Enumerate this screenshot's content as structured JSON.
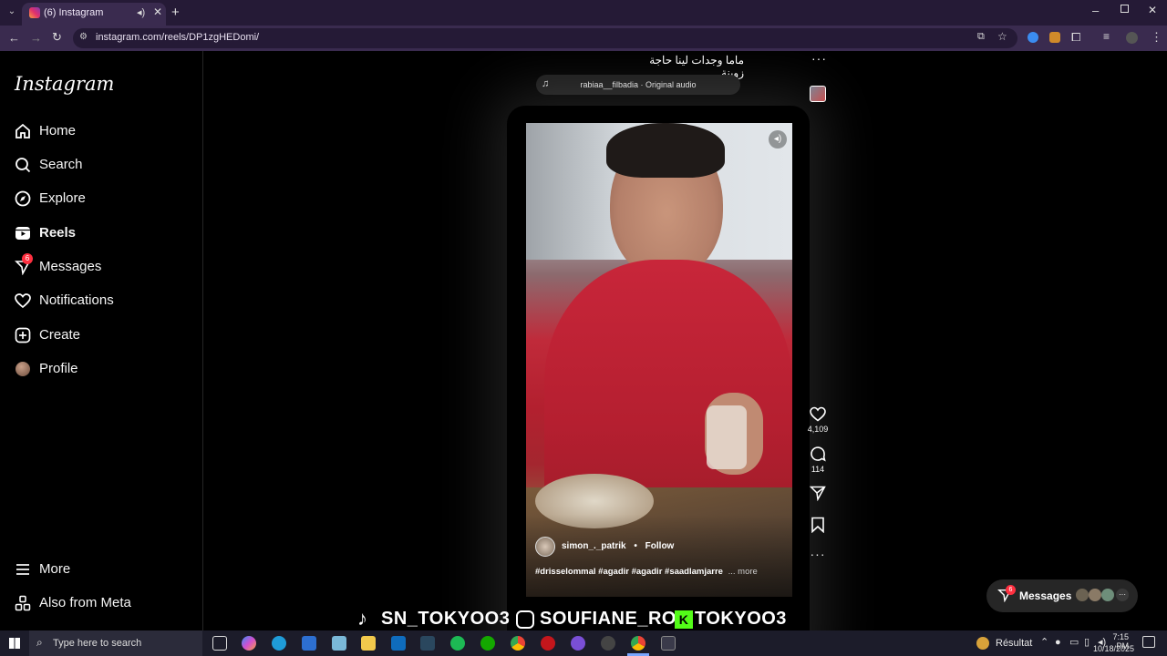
{
  "browser": {
    "tab_title": "(6) Instagram",
    "url": "instagram.com/reels/DP1zgHEDomi/"
  },
  "sidebar": {
    "logo": "Instagram",
    "items": [
      {
        "label": "Home",
        "icon": "home-icon"
      },
      {
        "label": "Search",
        "icon": "search-icon"
      },
      {
        "label": "Explore",
        "icon": "compass-icon"
      },
      {
        "label": "Reels",
        "icon": "reels-icon"
      },
      {
        "label": "Messages",
        "icon": "messenger-icon",
        "badge": "6"
      },
      {
        "label": "Notifications",
        "icon": "heart-icon"
      },
      {
        "label": "Create",
        "icon": "plus-square-icon"
      },
      {
        "label": "Profile",
        "icon": "avatar"
      }
    ],
    "more_label": "More",
    "meta_label": "Also from Meta"
  },
  "prev_reel": {
    "caption": "ماما وجدات لينا حاجة زوينة",
    "audio": "rabiaa__filbadia · Original audio"
  },
  "reel": {
    "username": "simon_._patrik",
    "separator": "•",
    "follow_label": "Follow",
    "hashtags": "#drisselommal #agadir #agadir #saadlamjarre",
    "more_label": "... more",
    "likes": "4,109",
    "comments": "114"
  },
  "overlay_banner": {
    "tiktok": "SN_TOKYOO3",
    "instagram": "SOUFIANE_RO",
    "kick": "TOKYOO3"
  },
  "messages_pill": {
    "label": "Messages",
    "badge": "6"
  },
  "taskbar": {
    "search_placeholder": "Type here to search",
    "weather": "Résultat",
    "time": "7:15 PM",
    "date": "10/18/2025"
  },
  "colors": {
    "accent_red": "#ff3040",
    "browser_bg": "#3a2b4f",
    "link": "#e0f1ff"
  }
}
